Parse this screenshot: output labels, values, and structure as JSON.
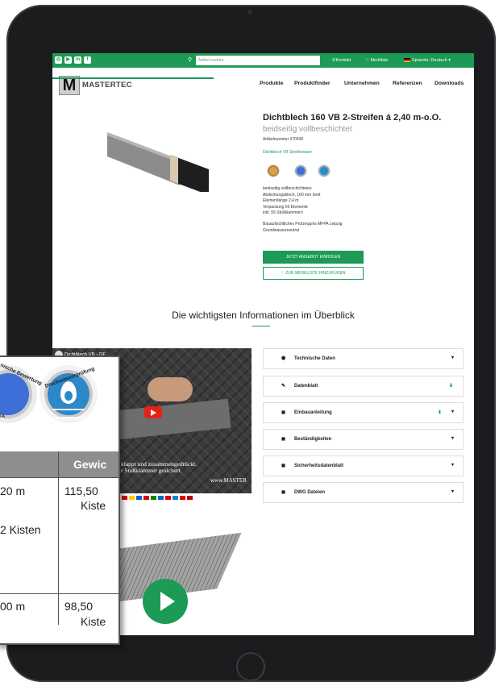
{
  "topbar": {
    "search_placeholder": "Artikel suchen",
    "kontakt": "Kontakt",
    "merkliste": "Merkliste",
    "sprache": "Sprache: Deutsch"
  },
  "brand": {
    "logo_letter": "M",
    "logo_text": "MASTERTEC"
  },
  "nav": [
    "Produkte",
    "Produktfinder",
    "Unternehmen",
    "Referenzen",
    "Downloads"
  ],
  "product": {
    "title": "Dichtblech 160 VB 2-Streifen á 2,40 m-o.O.",
    "subtitle": "beidseitig vollbeschichtet",
    "artikelnummer": "Artikelnummer 070430",
    "category": "Dichtblech VB Streifenware",
    "desc": [
      "beidseitig vollbeschichtetes",
      "Abdichtungsblech, 160 mm breit",
      "Elementlänge 2,4 m",
      "Verpackung 50 Elemente",
      "inkl. 55 Stoßklammern"
    ],
    "desc2": [
      "Bauaufsichtliches Prüfzeugnis MFPA Leipzig",
      "Grundwasserneutral"
    ],
    "btn_angebot": "JETZT ANGEBOT EINHOLEN",
    "btn_merkliste": "♡ ZUR MERKLISTE HINZUFÜGEN"
  },
  "section_title": "Die wichtigsten Informationen im Überblick",
  "video": {
    "title": "Dichtblech VB - DE",
    "caption": "klappt und zusammengedrückt.",
    "caption2": "r Stoßklammer gesichert.",
    "www": "www.MASTER"
  },
  "accordions": [
    {
      "label": "Technische Daten",
      "download": false
    },
    {
      "label": "Datenblatt",
      "download": true
    },
    {
      "label": "Einbauanleitung",
      "download": true
    },
    {
      "label": "Beständigkeiten",
      "download": false
    },
    {
      "label": "Sicherheitsdatenblatt",
      "download": false
    },
    {
      "label": "DWG Dateien",
      "download": false
    }
  ],
  "card": {
    "cert1_text": "nische Bewertung",
    "cert1_sub": "TA",
    "cert2_text": "Druckwasserprüfung",
    "header": "Gewic",
    "row1_len": "20 m",
    "row1_weight": "115,50",
    "row1_unit": "Kiste",
    "row1_kisten": "2 Kisten",
    "row2_len": "00 m",
    "row2_weight": "98,50",
    "row2_unit": "Kiste"
  },
  "colors": {
    "brand_green": "#1d9a55",
    "tablet_frame": "#1b1c1e"
  }
}
